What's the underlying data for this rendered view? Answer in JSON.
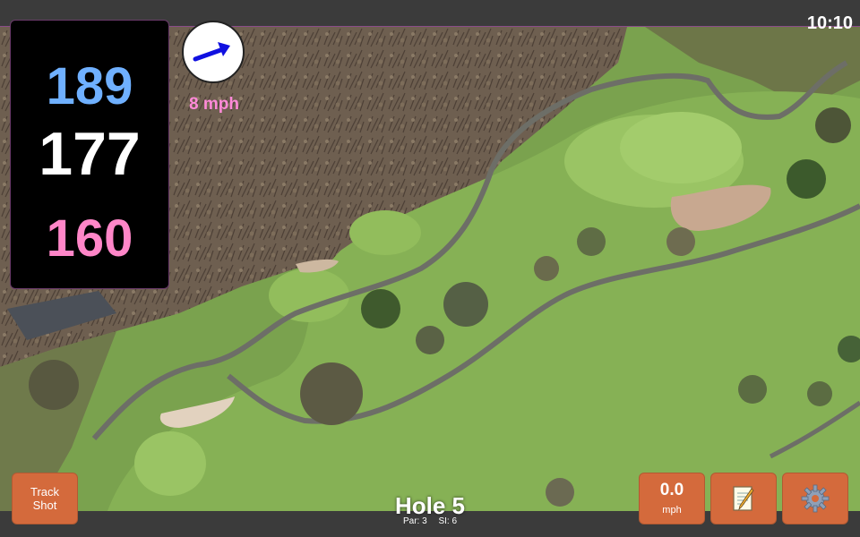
{
  "status": {
    "time": "10:10"
  },
  "distances": {
    "back": "189",
    "middle": "177",
    "front": "160"
  },
  "wind": {
    "speed": "8 mph",
    "direction_icon": "arrow-right-icon"
  },
  "buttons": {
    "track_shot_line1": "Track",
    "track_shot_line2": "Shot",
    "speed_value": "0.0",
    "speed_unit": "mph",
    "notes_icon": "notepad-icon",
    "settings_icon": "gear-icon"
  },
  "hole": {
    "title": "Hole 5",
    "par": "Par: 3",
    "si": "SI: 6"
  },
  "colors": {
    "back_distance": "#6fb0ff",
    "middle_distance": "#ffffff",
    "front_distance": "#ff86c8",
    "button": "#d46a3c",
    "wind_text": "#ff8ad8"
  }
}
